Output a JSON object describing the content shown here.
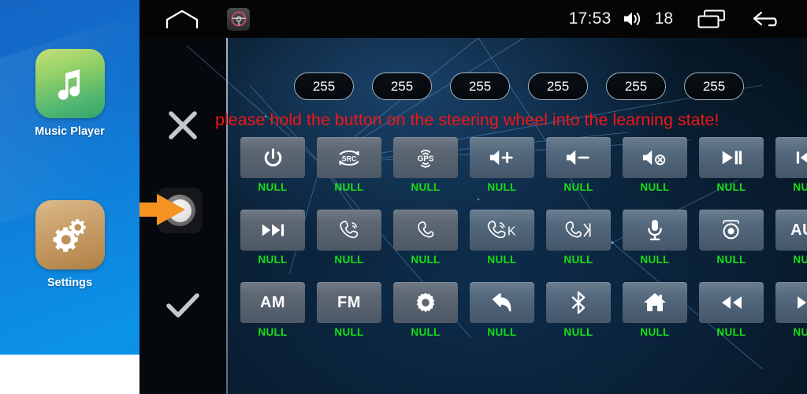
{
  "launcher": {
    "apps": [
      {
        "id": "music-player",
        "label": "Music Player",
        "icon": "music-note-icon"
      },
      {
        "id": "settings",
        "label": "Settings",
        "icon": "gears-icon"
      }
    ]
  },
  "statusbar": {
    "home_icon": "home-outline-icon",
    "steering_wheel_icon": "steering-wheel-icon",
    "time": "17:53",
    "volume_icon": "volume-icon",
    "volume_level": "18",
    "recents_icon": "recent-apps-icon",
    "back_icon": "back-arrow-icon"
  },
  "controls": {
    "cancel_icon": "close-x-icon",
    "confirm_icon": "check-icon",
    "knob_icon": "rotary-knob-icon",
    "pointer_icon": "orange-arrow-icon"
  },
  "pills": {
    "label": "channel-value",
    "values": [
      "255",
      "255",
      "255",
      "255",
      "255",
      "255"
    ]
  },
  "message": {
    "text": "please hold the button on the steering wheel into the learning state!",
    "color": "#f01717"
  },
  "grid": {
    "unassigned_label": "NULL",
    "label_color": "#16e016",
    "rows": [
      [
        {
          "icon": "power-icon",
          "text": "",
          "label": "NULL"
        },
        {
          "icon": "src-icon",
          "text": "",
          "label": "NULL"
        },
        {
          "icon": "gps-icon",
          "text": "",
          "label": "NULL"
        },
        {
          "icon": "volume-up-icon",
          "text": "",
          "label": "NULL"
        },
        {
          "icon": "volume-down-icon",
          "text": "",
          "label": "NULL"
        },
        {
          "icon": "volume-mute-icon",
          "text": "",
          "label": "NULL"
        },
        {
          "icon": "play-pause-icon",
          "text": "",
          "label": "NULL"
        },
        {
          "icon": "previous-track-icon",
          "text": "",
          "label": "NULL"
        }
      ],
      [
        {
          "icon": "next-track-icon",
          "text": "",
          "label": "NULL"
        },
        {
          "icon": "phone-answer-icon",
          "text": "",
          "label": "NULL"
        },
        {
          "icon": "phone-hangup-icon",
          "text": "",
          "label": "NULL"
        },
        {
          "icon": "phone-answer-k-icon",
          "text": "",
          "label": "NULL"
        },
        {
          "icon": "phone-hangup-arrow-icon",
          "text": "",
          "label": "NULL"
        },
        {
          "icon": "microphone-icon",
          "text": "",
          "label": "NULL"
        },
        {
          "icon": "camera-icon",
          "text": "",
          "label": "NULL"
        },
        {
          "icon": "",
          "text": "AUX",
          "label": "NULL"
        }
      ],
      [
        {
          "icon": "",
          "text": "AM",
          "label": "NULL"
        },
        {
          "icon": "",
          "text": "FM",
          "label": "NULL"
        },
        {
          "icon": "gear-icon",
          "text": "",
          "label": "NULL"
        },
        {
          "icon": "back-arrow-icon",
          "text": "",
          "label": "NULL"
        },
        {
          "icon": "bluetooth-icon",
          "text": "",
          "label": "NULL"
        },
        {
          "icon": "home-icon",
          "text": "",
          "label": "NULL"
        },
        {
          "icon": "rewind-icon",
          "text": "",
          "label": "NULL"
        },
        {
          "icon": "fast-forward-icon",
          "text": "",
          "label": "NULL"
        }
      ]
    ]
  }
}
